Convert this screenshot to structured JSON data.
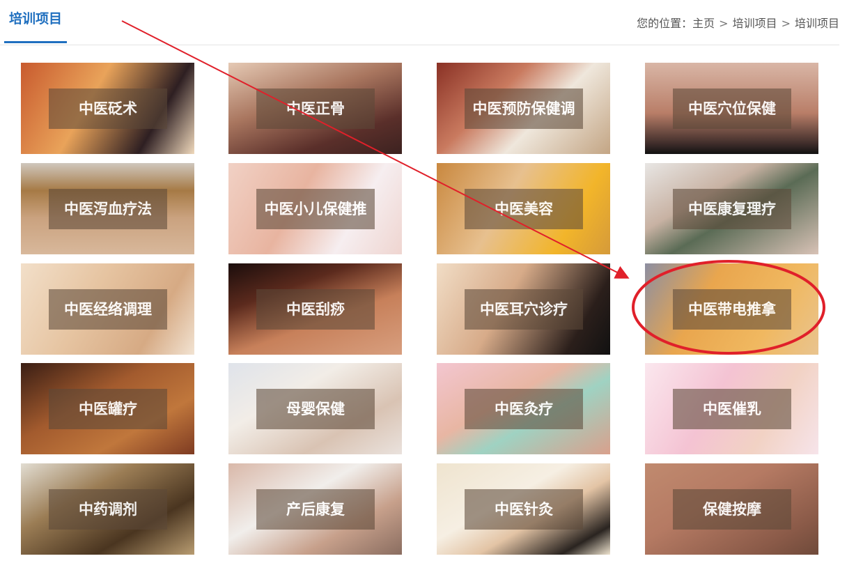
{
  "header": {
    "section_title": "培训项目",
    "breadcrumb": {
      "prefix": "您的位置：",
      "items": [
        "主页",
        "培训项目",
        "培训项目"
      ],
      "separator": ">"
    }
  },
  "tiles": [
    {
      "label": "中医砭术"
    },
    {
      "label": "中医正骨"
    },
    {
      "label": "中医预防保健调"
    },
    {
      "label": "中医穴位保健"
    },
    {
      "label": "中医泻血疗法"
    },
    {
      "label": "中医小儿保健推"
    },
    {
      "label": "中医美容"
    },
    {
      "label": "中医康复理疗"
    },
    {
      "label": "中医经络调理"
    },
    {
      "label": "中医刮痧"
    },
    {
      "label": "中医耳穴诊疗"
    },
    {
      "label": "中医带电推拿"
    },
    {
      "label": "中医罐疗"
    },
    {
      "label": "母婴保健"
    },
    {
      "label": "中医灸疗"
    },
    {
      "label": "中医催乳"
    },
    {
      "label": "中药调剂"
    },
    {
      "label": "产后康复"
    },
    {
      "label": "中医针灸"
    },
    {
      "label": "保健按摩"
    }
  ],
  "annotation": {
    "arrow_color": "#e0202a",
    "highlighted_tile": "中医带电推拿"
  },
  "colors": {
    "accent": "#1f6fbf",
    "caption_bg": "#5c4838"
  }
}
